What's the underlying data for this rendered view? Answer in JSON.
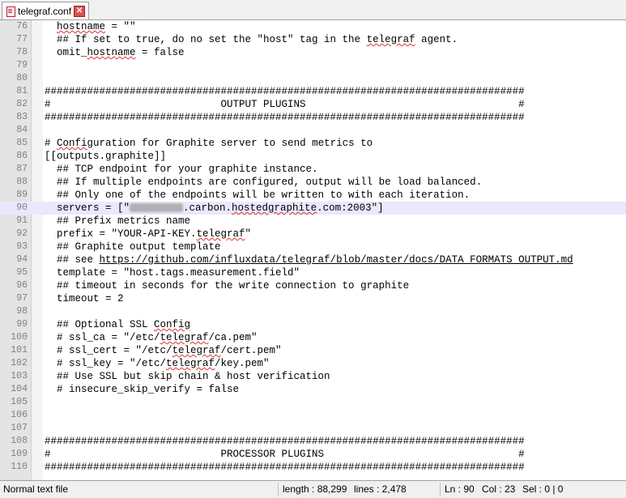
{
  "tab": {
    "filename": "telegraf.conf",
    "close_glyph": "✕"
  },
  "lines": [
    {
      "n": "76",
      "t": "  hostname = \"\""
    },
    {
      "n": "77",
      "t": "  ## If set to true, do no set the \"host\" tag in the telegraf agent."
    },
    {
      "n": "78",
      "t": "  omit_hostname = false"
    },
    {
      "n": "79",
      "t": ""
    },
    {
      "n": "80",
      "t": ""
    },
    {
      "n": "81",
      "t": "###############################################################################"
    },
    {
      "n": "82",
      "t": "#                            OUTPUT PLUGINS                                   #"
    },
    {
      "n": "83",
      "t": "###############################################################################"
    },
    {
      "n": "84",
      "t": ""
    },
    {
      "n": "85",
      "t": "# Configuration for Graphite server to send metrics to"
    },
    {
      "n": "86",
      "t": "[[outputs.graphite]]"
    },
    {
      "n": "87",
      "t": "  ## TCP endpoint for your graphite instance."
    },
    {
      "n": "88",
      "t": "  ## If multiple endpoints are configured, output will be load balanced."
    },
    {
      "n": "89",
      "t": "  ## Only one of the endpoints will be written to with each iteration."
    },
    {
      "n": "90",
      "t_before": "  servers = [\"",
      "t_after": ".carbon.hostedgraphite.com:2003\"]"
    },
    {
      "n": "91",
      "t": "  ## Prefix metrics name"
    },
    {
      "n": "92",
      "t": "  prefix = \"YOUR-API-KEY.telegraf\""
    },
    {
      "n": "93",
      "t": "  ## Graphite output template"
    },
    {
      "n": "94",
      "t_before": "  ## see ",
      "link": "https://github.com/influxdata/telegraf/blob/master/docs/DATA_FORMATS_OUTPUT.md"
    },
    {
      "n": "95",
      "t": "  template = \"host.tags.measurement.field\""
    },
    {
      "n": "96",
      "t": "  ## timeout in seconds for the write connection to graphite"
    },
    {
      "n": "97",
      "t": "  timeout = 2"
    },
    {
      "n": "98",
      "t": ""
    },
    {
      "n": "99",
      "t": "  ## Optional SSL Config"
    },
    {
      "n": "100",
      "t": "  # ssl_ca = \"/etc/telegraf/ca.pem\""
    },
    {
      "n": "101",
      "t": "  # ssl_cert = \"/etc/telegraf/cert.pem\""
    },
    {
      "n": "102",
      "t": "  # ssl_key = \"/etc/telegraf/key.pem\""
    },
    {
      "n": "103",
      "t": "  ## Use SSL but skip chain & host verification"
    },
    {
      "n": "104",
      "t": "  # insecure_skip_verify = false"
    },
    {
      "n": "105",
      "t": ""
    },
    {
      "n": "106",
      "t": ""
    },
    {
      "n": "107",
      "t": ""
    },
    {
      "n": "108",
      "t": "###############################################################################"
    },
    {
      "n": "109",
      "t": "#                            PROCESSOR PLUGINS                                #"
    },
    {
      "n": "110",
      "t": "###############################################################################"
    }
  ],
  "current_line": "90",
  "status": {
    "filetype": "Normal text file",
    "length": "length : 88,299",
    "lines": "lines : 2,478",
    "ln": "Ln : 90",
    "col": "Col : 23",
    "sel": "Sel : 0 | 0"
  }
}
